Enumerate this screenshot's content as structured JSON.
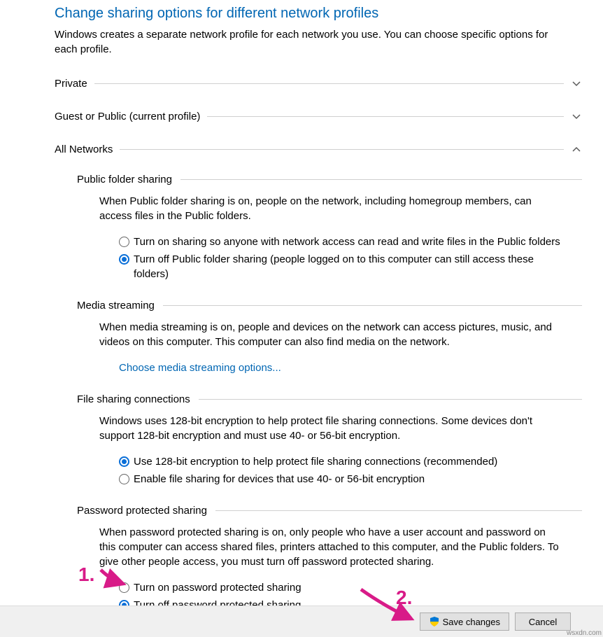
{
  "title": "Change sharing options for different network profiles",
  "intro": "Windows creates a separate network profile for each network you use. You can choose specific options for each profile.",
  "sections": {
    "private": {
      "label": "Private"
    },
    "guest": {
      "label": "Guest or Public (current profile)"
    },
    "all": {
      "label": "All Networks"
    }
  },
  "publicFolder": {
    "header": "Public folder sharing",
    "description": "When Public folder sharing is on, people on the network, including homegroup members, can access files in the Public folders.",
    "option_on": "Turn on sharing so anyone with network access can read and write files in the Public folders",
    "option_off": "Turn off Public folder sharing (people logged on to this computer can still access these folders)"
  },
  "mediaStreaming": {
    "header": "Media streaming",
    "description": "When media streaming is on, people and devices on the network can access pictures, music, and videos on this computer. This computer can also find media on the network.",
    "link": "Choose media streaming options..."
  },
  "fileSharing": {
    "header": "File sharing connections",
    "description": "Windows uses 128-bit encryption to help protect file sharing connections. Some devices don't support 128-bit encryption and must use 40- or 56-bit encryption.",
    "option_128": "Use 128-bit encryption to help protect file sharing connections (recommended)",
    "option_40": "Enable file sharing for devices that use 40- or 56-bit encryption"
  },
  "passwordSharing": {
    "header": "Password protected sharing",
    "description": "When password protected sharing is on, only people who have a user account and password on this computer can access shared files, printers attached to this computer, and the Public folders. To give other people access, you must turn off password protected sharing.",
    "option_on": "Turn on password protected sharing",
    "option_off": "Turn off password protected sharing"
  },
  "buttons": {
    "save": "Save changes",
    "cancel": "Cancel"
  },
  "annotations": {
    "num1": "1.",
    "num2": "2."
  },
  "watermark": "wsxdn.com"
}
